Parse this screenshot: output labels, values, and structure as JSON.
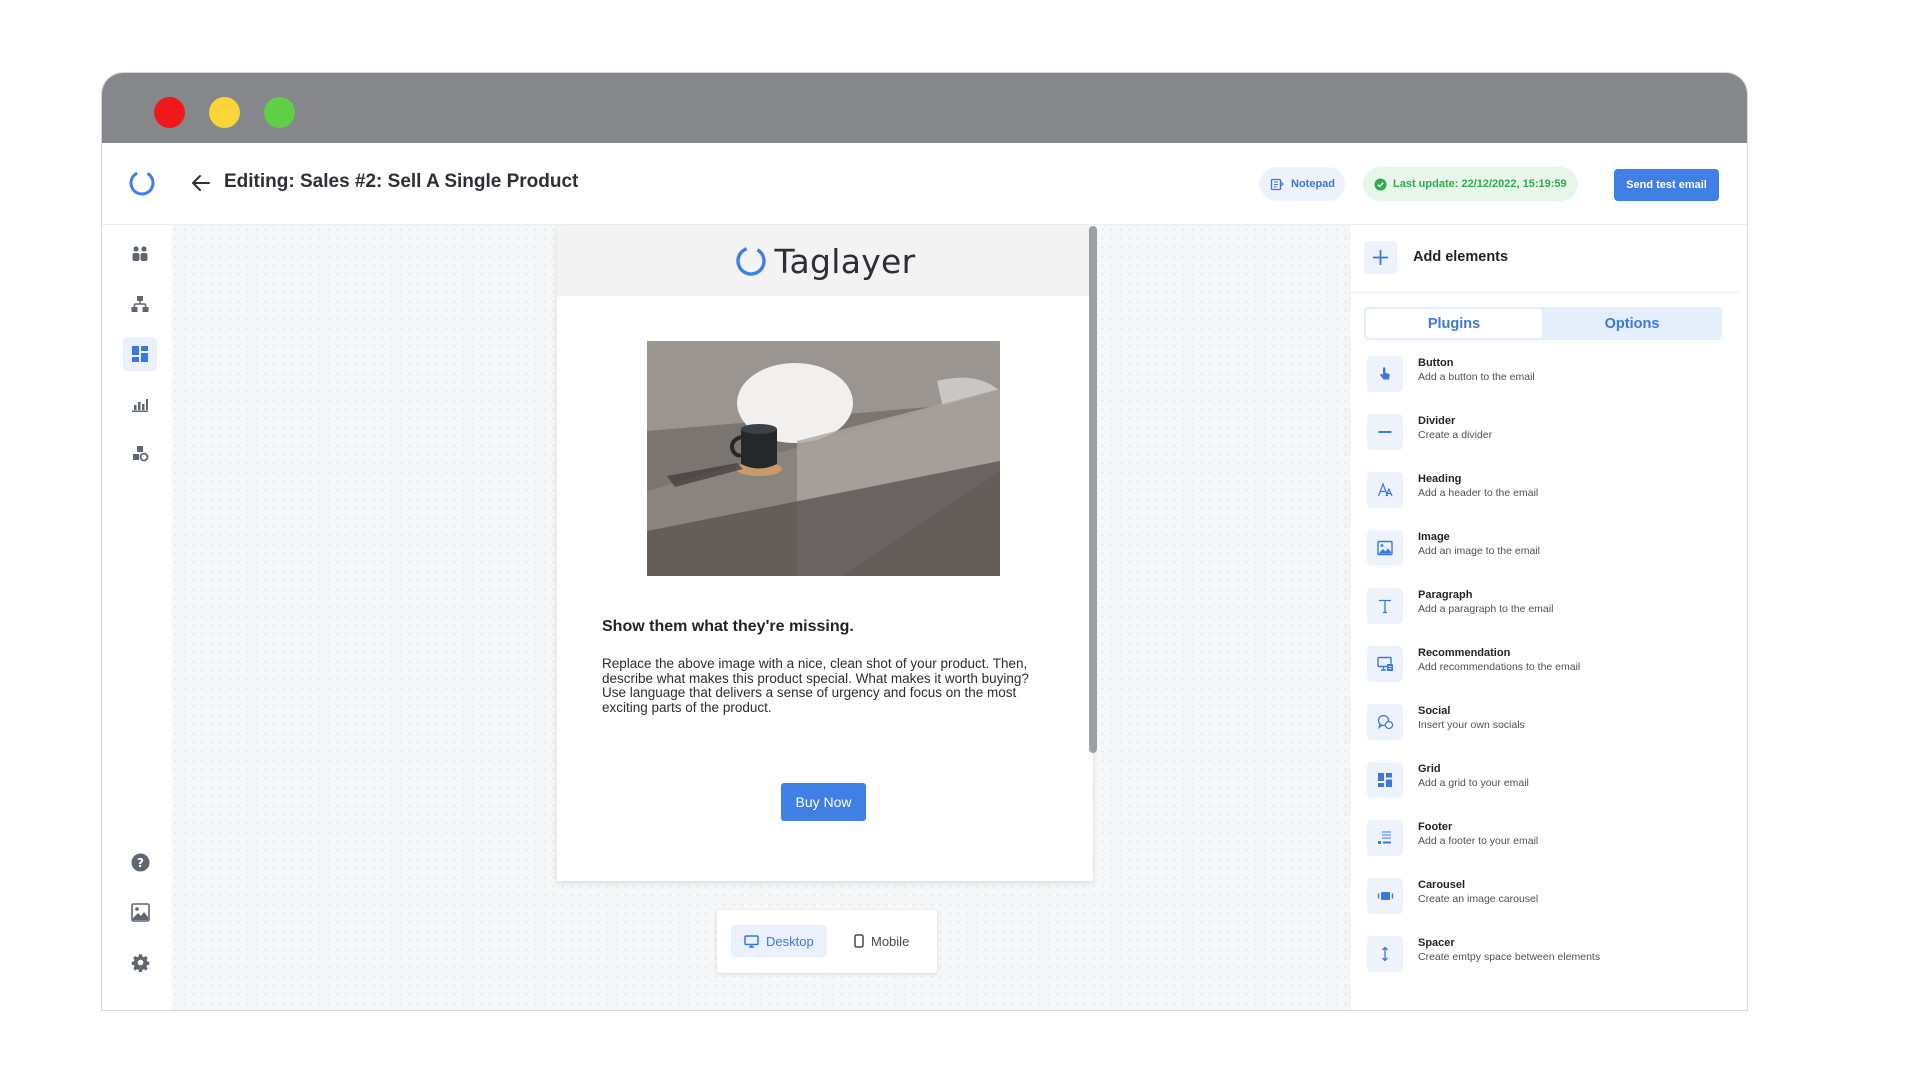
{
  "window": {
    "controls": [
      "close",
      "minimize",
      "maximize"
    ]
  },
  "header": {
    "title": "Editing: Sales #2: Sell A Single Product",
    "notepad_label": "Notepad",
    "last_update": "Last update: 22/12/2022, 15:19:59",
    "send_test_label": "Send test email"
  },
  "sidebar": {
    "items": [
      {
        "icon": "people-icon",
        "active": false
      },
      {
        "icon": "hierarchy-icon",
        "active": false
      },
      {
        "icon": "dashboard-grid-icon",
        "active": true
      },
      {
        "icon": "bar-chart-icon",
        "active": false
      },
      {
        "icon": "cubes-icon",
        "active": false
      }
    ],
    "bottom_items": [
      {
        "icon": "help-icon"
      },
      {
        "icon": "image-gallery-icon"
      },
      {
        "icon": "gear-icon"
      },
      {
        "icon": "contact-card-icon"
      }
    ]
  },
  "email": {
    "brand": "Taglayer",
    "heading": "Show them what they're missing.",
    "paragraph": "Replace the above image with a nice, clean shot of your product. Then, describe what makes this product special. What makes it worth buying? Use language that delivers a sense of urgency and focus on the most exciting parts of the product.",
    "button_label": "Buy Now"
  },
  "view_toggle": {
    "desktop": "Desktop",
    "mobile": "Mobile",
    "selected": "Desktop"
  },
  "panel": {
    "title": "Add elements",
    "tabs": {
      "plugins": "Plugins",
      "options": "Options",
      "selected": "Plugins"
    },
    "plugins": [
      {
        "name": "Button",
        "desc": "Add a button to the email",
        "icon": "pointer-hand-icon"
      },
      {
        "name": "Divider",
        "desc": "Create a divider",
        "icon": "divider-line-icon"
      },
      {
        "name": "Heading",
        "desc": "Add a header to the email",
        "icon": "font-letter-icon"
      },
      {
        "name": "Image",
        "desc": "Add an image to the email",
        "icon": "image-icon"
      },
      {
        "name": "Paragraph",
        "desc": "Add a paragraph to the email",
        "icon": "text-t-icon"
      },
      {
        "name": "Recommendation",
        "desc": "Add recommendations to the email",
        "icon": "recommendation-icon"
      },
      {
        "name": "Social",
        "desc": "Insert your own socials",
        "icon": "chat-bubbles-icon"
      },
      {
        "name": "Grid",
        "desc": "Add a grid to your email",
        "icon": "grid-icon"
      },
      {
        "name": "Footer",
        "desc": "Add a footer to your email",
        "icon": "footer-icon"
      },
      {
        "name": "Carousel",
        "desc": "Create an image carousel",
        "icon": "carousel-icon"
      },
      {
        "name": "Spacer",
        "desc": "Create emtpy space between elements",
        "icon": "vertical-arrows-icon"
      }
    ]
  },
  "colors": {
    "accent": "#3f7fe6",
    "success": "#2fab4b",
    "titlebar": "#86878b"
  }
}
